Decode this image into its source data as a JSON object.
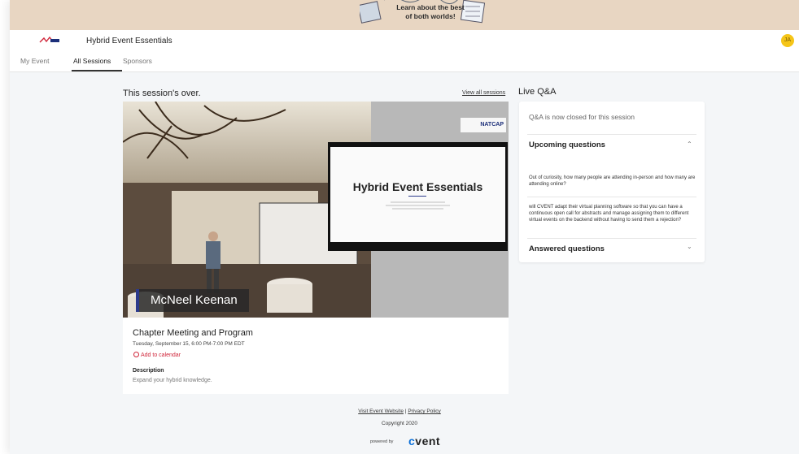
{
  "banner": {
    "line1": "Learn about the best",
    "line2": "of both worlds!"
  },
  "header": {
    "event_title": "Hybrid Event Essentials",
    "avatar_initials": "JA"
  },
  "tabs": [
    {
      "label": "My Event"
    },
    {
      "label": "All Sessions",
      "active": true
    },
    {
      "label": "Sponsors"
    }
  ],
  "session": {
    "status": "This session's over.",
    "view_all": "View all sessions",
    "speaker_name": "McNeel Keenan",
    "slide_title": "Hybrid Event Essentials",
    "slide_logo": "NATCAP",
    "title": "Chapter Meeting and Program",
    "time": "Tuesday, September 15, 6:00 PM-7:00 PM EDT",
    "add_calendar": "Add to calendar",
    "description_label": "Description",
    "description": "Expand your hybrid knowledge."
  },
  "qa": {
    "heading": "Live Q&A",
    "closed_note": "Q&A is now closed for this session",
    "upcoming_label": "Upcoming questions",
    "questions": [
      "Out of curiosity, how many people are attending in-person and how many are attending online?",
      "will CVENT adapt their virtual planning software so that you can have a continuous open call for abstracts and manage assigning them to different virtual events on the backend without having to send them a rejection?"
    ],
    "answered_label": "Answered questions"
  },
  "footer": {
    "visit_link": "Visit Event Website",
    "privacy_link": "Privacy Policy",
    "separator": "|",
    "copyright": "Copyright 2020",
    "powered_by": "powered by",
    "brand_c": "c",
    "brand_rest": "vent"
  },
  "colors": {
    "banner": "#e8d6c2",
    "accent_red": "#d0263a",
    "avatar": "#f5c518",
    "cvent_blue": "#0a6fd8",
    "name_bar": "#2c3a8c"
  }
}
